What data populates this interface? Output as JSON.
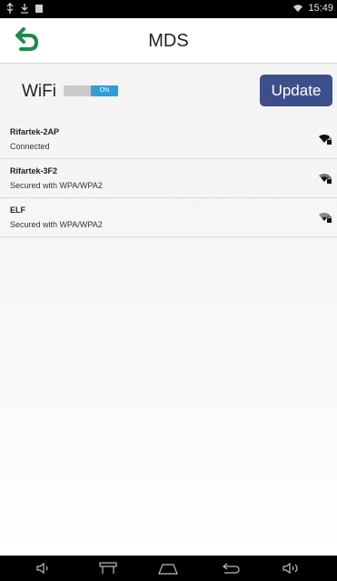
{
  "status_bar": {
    "time": "15:49",
    "left_icons": [
      "usb-icon",
      "download-icon",
      "sd-card-icon"
    ],
    "right_icons": [
      "wifi-icon"
    ]
  },
  "app_bar": {
    "title": "MDS",
    "back_icon": "back-arrow-icon",
    "back_color": "#1f8a4c"
  },
  "wifi_controls": {
    "label": "WiFi",
    "toggle_text": "ON",
    "toggle_state": "on",
    "update_label": "Update",
    "accent": "#3c4f8a",
    "toggle_color": "#2f9fd8"
  },
  "networks": [
    {
      "name": "Rifartek-2AP",
      "status": "Connected",
      "signal_icon": "wifi-lock-icon"
    },
    {
      "name": "Rifartek-3F2",
      "status": "Secured with WPA/WPA2",
      "signal_icon": "wifi-lock-icon"
    },
    {
      "name": "ELF",
      "status": "Secured with WPA/WPA2",
      "signal_icon": "wifi-lock-icon"
    }
  ],
  "nav_bar": {
    "icons": [
      "volume-down-icon",
      "recent-apps-icon",
      "home-icon",
      "back-icon",
      "volume-up-icon"
    ]
  }
}
